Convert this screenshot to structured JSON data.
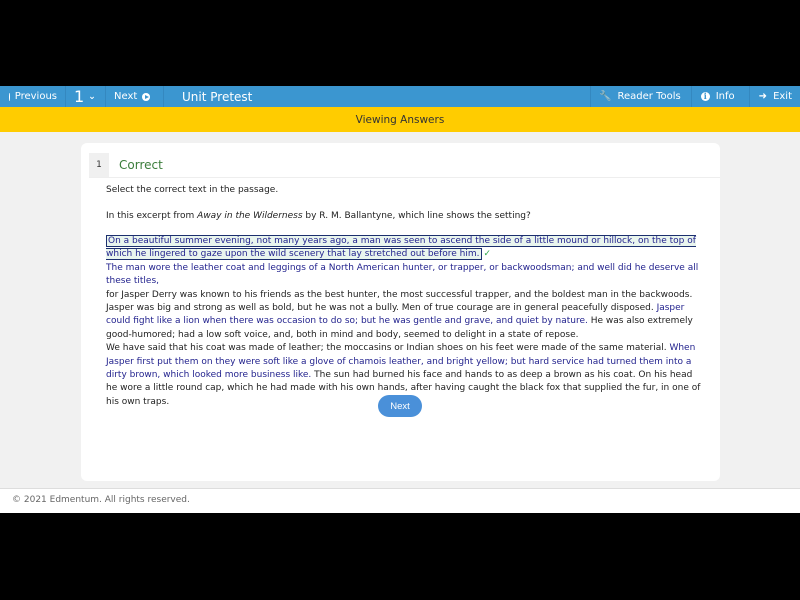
{
  "topbar": {
    "previous_label": "Previous",
    "question_number": "1",
    "next_label": "Next",
    "title": "Unit Pretest",
    "reader_tools_label": "Reader Tools",
    "info_label": "Info",
    "exit_label": "Exit"
  },
  "banner": {
    "text": "Viewing Answers"
  },
  "question": {
    "number": "1",
    "status": "Correct",
    "instruction": "Select the correct text in the passage.",
    "prompt_before": "In this excerpt from ",
    "prompt_title": "Away in the Wilderness",
    "prompt_after": " by R. M. Ballantyne, which line shows the setting?",
    "passage": {
      "s1_selected": "On a beautiful summer evening, not many years ago, a man was seen to ascend the side of a little mound or hillock, on the top of which he lingered to gaze upon the wild scenery that lay stretched out before him.",
      "s2_option": " The man wore the leather coat and leggings of a North American hunter, or trapper, or backwoodsman; and well did he deserve all these titles,",
      "s3_plain": "for Jasper Derry was known to his friends as the best hunter, the most successful trapper, and the boldest man in the backwoods.",
      "s4_plain": "Jasper was big and strong as well as bold, but he was not a bully. Men of true courage are in general peacefully disposed. ",
      "s5_option": "Jasper could fight like a lion when there was occasion to do so; but he was gentle and grave, and quiet by nature.",
      "s6_plain": " He was also extremely good-humored; had a low soft voice, and, both in mind and body, seemed to delight in a state of repose.",
      "s7_plain": "We have said that his coat was made of leather; the moccasins or Indian shoes on his feet were made of the same material. ",
      "s8_option": "When Jasper first put them on they were soft like a glove of chamois leather, and bright yellow; but hard service had turned them into a dirty brown, which looked more business like.",
      "s9_plain": " The sun had burned his face and hands to as deep a brown as his coat. On his head he wore a little round cap, which he had made with his own hands, after having caught the black fox that supplied the fur, in one of his own traps."
    },
    "next_button": "Next"
  },
  "footer": {
    "copyright": "© 2021 Edmentum. All rights reserved."
  },
  "colors": {
    "topbar": "#3b96d0",
    "banner": "#ffcc00",
    "correct": "#3b7d3b",
    "option_text": "#23238e",
    "check": "#2fa84a",
    "button": "#4a90d9"
  }
}
